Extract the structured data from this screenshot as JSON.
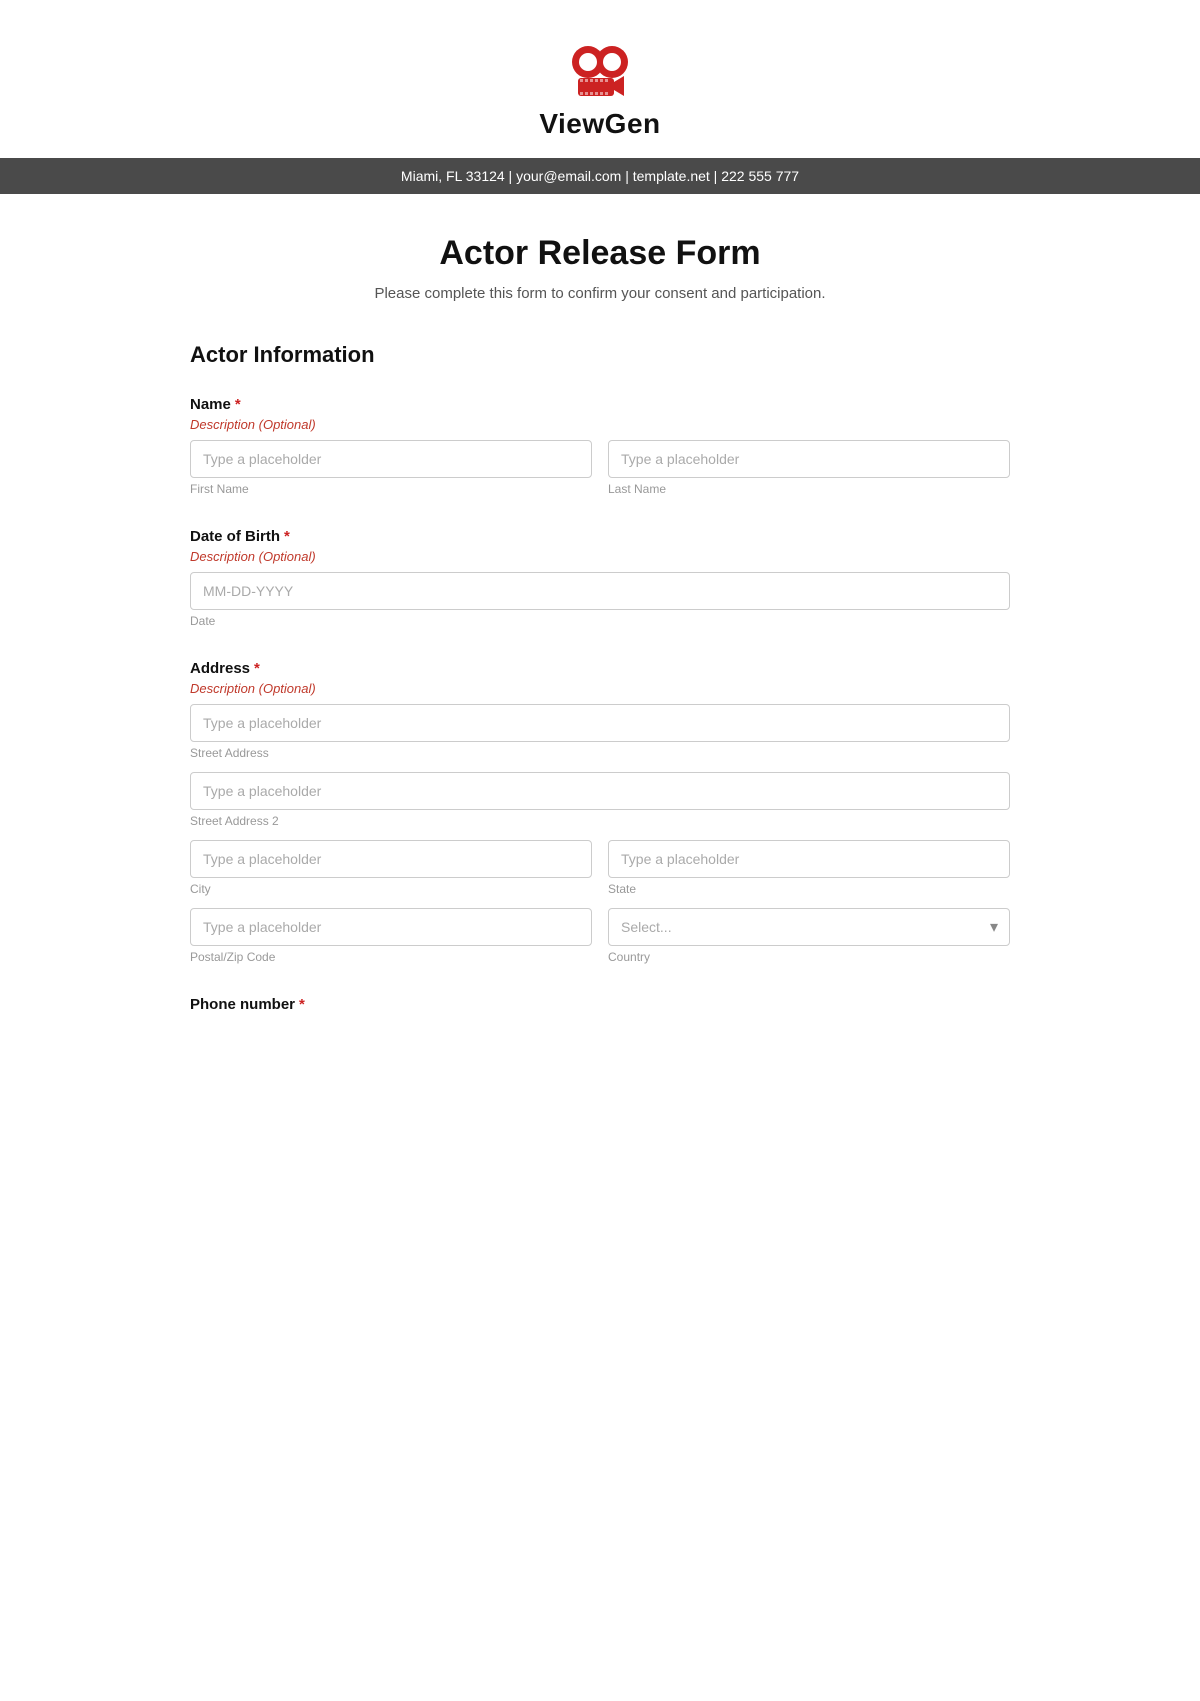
{
  "header": {
    "brand_name": "ViewGen",
    "contact_info": "Miami, FL 33124 | your@email.com | template.net | 222 555 777"
  },
  "form": {
    "title": "Actor Release Form",
    "subtitle": "Please complete this form to confirm your consent and participation.",
    "section_title": "Actor Information",
    "fields": {
      "name": {
        "label": "Name",
        "required": true,
        "description": "Description (Optional)",
        "first_name": {
          "placeholder": "Type a placeholder",
          "sublabel": "First Name"
        },
        "last_name": {
          "placeholder": "Type a placeholder",
          "sublabel": "Last Name"
        }
      },
      "dob": {
        "label": "Date of Birth",
        "required": true,
        "description": "Description (Optional)",
        "placeholder": "MM-DD-YYYY",
        "sublabel": "Date"
      },
      "address": {
        "label": "Address",
        "required": true,
        "description": "Description (Optional)",
        "street1": {
          "placeholder": "Type a placeholder",
          "sublabel": "Street Address"
        },
        "street2": {
          "placeholder": "Type a placeholder",
          "sublabel": "Street Address 2"
        },
        "city": {
          "placeholder": "Type a placeholder",
          "sublabel": "City"
        },
        "state": {
          "placeholder": "Type a placeholder",
          "sublabel": "State"
        },
        "postal": {
          "placeholder": "Type a placeholder",
          "sublabel": "Postal/Zip Code"
        },
        "country": {
          "placeholder": "Select...",
          "sublabel": "Country"
        }
      },
      "phone": {
        "label": "Phone number",
        "required": true
      }
    }
  },
  "select_label": "Select"
}
